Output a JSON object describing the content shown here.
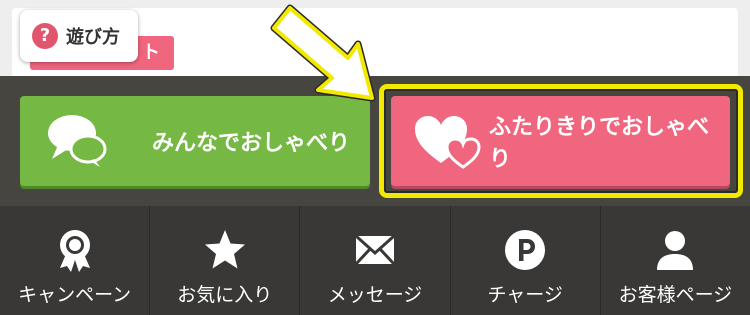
{
  "top": {
    "pink_tag_text": "ト",
    "howto_icon_text": "?",
    "howto_label": "遊び方"
  },
  "actions": {
    "group_chat_label": "みんなでおしゃべり",
    "private_chat_label": "ふたりきりでおしゃべり",
    "group_chat_icon": "speech-bubbles-icon",
    "private_chat_icon": "hearts-icon"
  },
  "nav": [
    {
      "label": "キャンペーン",
      "icon": "award-ribbon-icon"
    },
    {
      "label": "お気に入り",
      "icon": "star-icon"
    },
    {
      "label": "メッセージ",
      "icon": "envelope-icon"
    },
    {
      "label": "チャージ",
      "icon": "points-p-icon"
    },
    {
      "label": "お客様ページ",
      "icon": "user-icon"
    }
  ],
  "colors": {
    "green": "#75b843",
    "pink": "#f0667e",
    "highlight": "#f2e900",
    "nav_bg": "#393837"
  }
}
